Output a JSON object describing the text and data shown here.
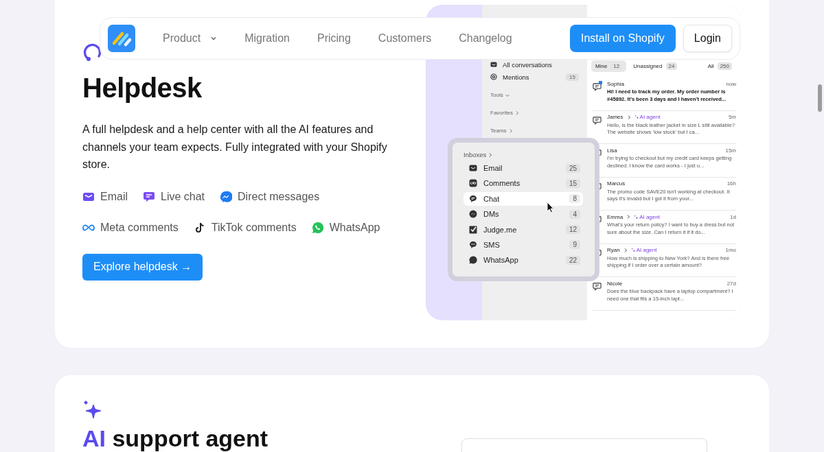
{
  "nav": {
    "items": [
      {
        "label": "Product",
        "dropdown": true
      },
      {
        "label": "Migration",
        "dropdown": false
      },
      {
        "label": "Pricing",
        "dropdown": false
      },
      {
        "label": "Customers",
        "dropdown": false
      },
      {
        "label": "Changelog",
        "dropdown": false
      }
    ],
    "cta": "Install on Shopify",
    "login": "Login"
  },
  "helpdesk": {
    "title": "Helpdesk",
    "description": "A full helpdesk and a help center with all the AI features and channels your team expects. Fully integrated with your Shopify store.",
    "channels": [
      {
        "kind": "email",
        "label": "Email"
      },
      {
        "kind": "livechat",
        "label": "Live chat"
      },
      {
        "kind": "messenger",
        "label": "Direct messages"
      },
      {
        "kind": "meta",
        "label": "Meta comments"
      },
      {
        "kind": "tiktok",
        "label": "TikTok comments"
      },
      {
        "kind": "whatsapp",
        "label": "WhatsApp"
      }
    ],
    "button": "Explore helpdesk →",
    "mockup": {
      "sidebar": {
        "items": [
          {
            "kind": "inbox",
            "label": "All conversations"
          },
          {
            "kind": "at",
            "label": "Mentions",
            "count": "15"
          }
        ],
        "sections": [
          {
            "label": "Tools",
            "expanded": true
          },
          {
            "label": "Favorites",
            "expanded": false
          },
          {
            "label": "Teams",
            "expanded": false
          }
        ]
      },
      "inboxes": {
        "title": "Inboxes",
        "items": [
          {
            "kind": "email",
            "label": "Email",
            "count": "25",
            "selected": false
          },
          {
            "kind": "meta",
            "label": "Comments",
            "count": "15",
            "selected": false
          },
          {
            "kind": "chat",
            "label": "Chat",
            "count": "8",
            "selected": true
          },
          {
            "kind": "messenger",
            "label": "DMs",
            "count": "4",
            "selected": false
          },
          {
            "kind": "judge",
            "label": "Judge.me",
            "count": "12",
            "selected": false
          },
          {
            "kind": "sms",
            "label": "SMS",
            "count": "9",
            "selected": false
          },
          {
            "kind": "whatsapp",
            "label": "WhatsApp",
            "count": "22",
            "selected": false
          }
        ]
      },
      "tabs": [
        {
          "label": "Mine",
          "count": "12",
          "selected": true
        },
        {
          "label": "Unassigned",
          "count": "24",
          "selected": false
        },
        {
          "label": "All",
          "count": "250",
          "selected": false
        }
      ],
      "conversations": [
        {
          "name": "Sophia",
          "time": "now",
          "unread": true,
          "preview": "Hi! I need to track my order. My order number is #45892. It's been 3 days and I haven't received..."
        },
        {
          "name": "James",
          "agent": "AI agent",
          "time": "5m",
          "unread": false,
          "preview": "Hello, is the black leather jacket in size L still available? The website shows 'low stock' but I ca..."
        },
        {
          "name": "Lisa",
          "time": "15m",
          "unread": false,
          "preview": "I'm trying to checkout but my credit card keeps getting declined. I know the card works - I just u..."
        },
        {
          "name": "Marcus",
          "time": "16h",
          "unread": false,
          "preview": "The promo code SAVE20 isn't working at checkout. It says it's invalid but I got it from your..."
        },
        {
          "name": "Emma",
          "agent": "AI agent",
          "time": "1d",
          "unread": false,
          "preview": "What's your return policy? I want to buy a dress but not sure about the size. Can I return it if it do..."
        },
        {
          "name": "Ryan",
          "agent": "AI agent",
          "time": "1mo",
          "unread": false,
          "preview": "How much is shipping to New York? And is there free shipping if I order over a certain amount?"
        },
        {
          "name": "Nicole",
          "time": "27d",
          "unread": false,
          "preview": "Does the blue backpack have a laptop compartment? I need one that fits a 15-inch lapt..."
        }
      ]
    }
  },
  "agent_section": {
    "title_accent": "AI",
    "title_rest": "support agent"
  }
}
